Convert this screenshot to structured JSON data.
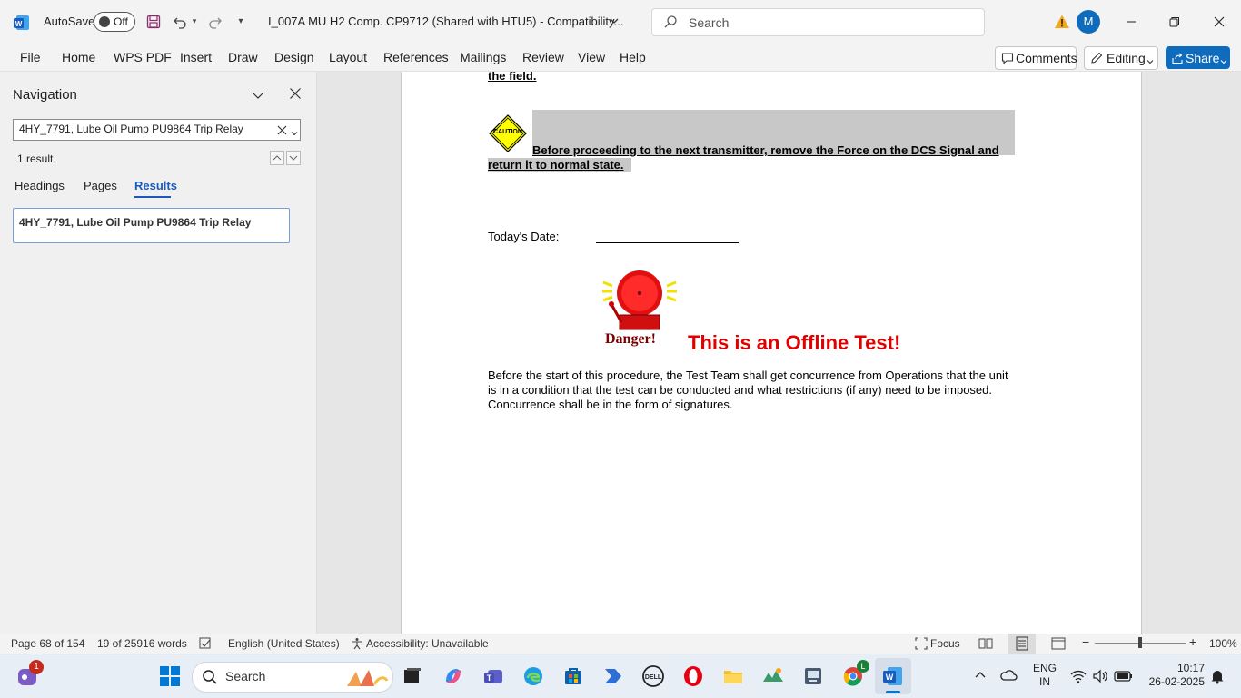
{
  "titlebar": {
    "app_icon": "word-icon",
    "autosave_label": "AutoSave",
    "autosave_state": "Off",
    "doc_title": "I_007A MU H2 Comp. CP9712 (Shared with HTU5)  -  Compatibility...",
    "search_placeholder": "Search",
    "avatar_initial": "M"
  },
  "menu": {
    "items": [
      "File",
      "Home",
      "WPS PDF",
      "Insert",
      "Draw",
      "Design",
      "Layout",
      "References",
      "Mailings",
      "Review",
      "View",
      "Help"
    ],
    "comments_label": "Comments",
    "editing_label": "Editing",
    "share_label": "Share"
  },
  "navigation": {
    "title": "Navigation",
    "search_value": "4HY_7791, Lube Oil Pump PU9864 Trip Relay",
    "result_count": "1 result",
    "tabs": [
      "Headings",
      "Pages",
      "Results"
    ],
    "active_tab": "Results",
    "result_item": "4HY_7791, Lube Oil Pump PU9864 Trip Relay"
  },
  "document": {
    "top_text": "the field.",
    "caution_label": "CAUTION",
    "caution_line1": "Before proceeding to the next transmitter, remove the Force on the DCS Signal and",
    "caution_line2": "return it to normal state.",
    "date_label": "Today's Date:",
    "danger_label": "Danger!",
    "offline_text": "This is an Offline Test!",
    "para_line1": "Before the start of this procedure, the Test Team shall get concurrence from Operations that the unit",
    "para_line2": "is in a condition that the test can be conducted and what restrictions (if any) need to be imposed.",
    "para_line3": "Concurrence shall be in the form of signatures."
  },
  "statusbar": {
    "page": "Page 68 of 154",
    "words": "19 of 25916 words",
    "language": "English (United States)",
    "accessibility": "Accessibility: Unavailable",
    "focus": "Focus",
    "zoom": "100%"
  },
  "taskbar": {
    "search_label": "Search",
    "notification_count": "1",
    "chrome_badge": "L",
    "lang_line1": "ENG",
    "lang_line2": "IN",
    "time": "10:17",
    "date": "26-02-2025"
  },
  "colors": {
    "word_blue": "#185abd",
    "share_blue": "#0f6cbd",
    "danger_red": "#e00000",
    "caution_yellow": "#ffff00"
  }
}
